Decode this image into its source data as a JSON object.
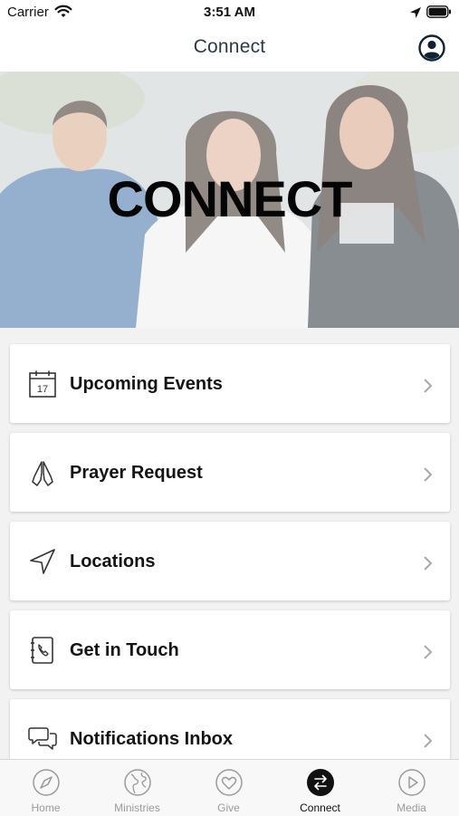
{
  "status_bar": {
    "carrier": "Carrier",
    "time": "3:51 AM"
  },
  "header": {
    "title": "Connect",
    "profile_icon": "person-circle-icon"
  },
  "hero": {
    "title": "CONNECT",
    "image": "photo-three-smiling-friends"
  },
  "menu": [
    {
      "label": "Upcoming Events",
      "icon": "calendar-icon",
      "calendar_day": "17"
    },
    {
      "label": "Prayer Request",
      "icon": "praying-hands-icon"
    },
    {
      "label": "Locations",
      "icon": "navigation-arrow-icon"
    },
    {
      "label": "Get in Touch",
      "icon": "phone-book-icon"
    },
    {
      "label": "Notifications Inbox",
      "icon": "chat-bubbles-icon"
    }
  ],
  "tabs": [
    {
      "label": "Home",
      "icon": "compass-icon",
      "active": false
    },
    {
      "label": "Ministries",
      "icon": "globe-icon",
      "active": false
    },
    {
      "label": "Give",
      "icon": "heart-icon",
      "active": false
    },
    {
      "label": "Connect",
      "icon": "swap-arrows-icon",
      "active": true
    },
    {
      "label": "Media",
      "icon": "play-icon",
      "active": false
    }
  ],
  "colors": {
    "title_text": "#2a3a48",
    "active_tab": "#111111",
    "inactive_tab": "#9a9a9a",
    "background": "#f2f2f2"
  }
}
